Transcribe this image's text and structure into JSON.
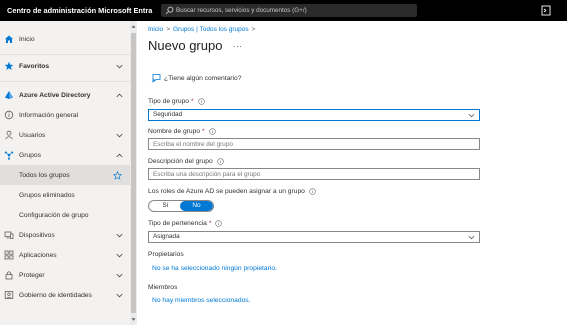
{
  "header": {
    "app_title": "Centro de administración Microsoft Entra",
    "search_placeholder": "Buscar recursos, servicios y documentos (G+/)"
  },
  "sidebar": {
    "items": [
      {
        "label": "Inicio",
        "icon": "home-icon"
      },
      {
        "label": "Favoritos",
        "icon": "star-icon"
      },
      {
        "label": "Azure Active Directory",
        "icon": "azure-ad-icon"
      },
      {
        "label": "Información general",
        "icon": "info-icon"
      },
      {
        "label": "Usuarios",
        "icon": "user-icon"
      },
      {
        "label": "Grupos",
        "icon": "groups-icon"
      },
      {
        "label": "Todos los grupos"
      },
      {
        "label": "Grupos eliminados"
      },
      {
        "label": "Configuración de grupo"
      },
      {
        "label": "Dispositivos",
        "icon": "devices-icon"
      },
      {
        "label": "Aplicaciones",
        "icon": "apps-icon"
      },
      {
        "label": "Proteger",
        "icon": "lock-icon"
      },
      {
        "label": "Gobierno de identidades",
        "icon": "governance-icon"
      }
    ]
  },
  "breadcrumb": {
    "home": "Inicio",
    "groups": "Grupos | Todos los grupos",
    "separator": ">"
  },
  "page": {
    "title": "Nuevo grupo",
    "more": "...",
    "feedback": "¿Tiene algún comentario?"
  },
  "form": {
    "group_type_label": "Tipo de grupo",
    "group_type_value": "Seguridad",
    "group_name_label": "Nombre de grupo",
    "group_name_placeholder": "Escriba el nombre del grupo",
    "description_label": "Descripción del grupo",
    "description_placeholder": "Escriba una descripción para el grupo",
    "roles_label": "Los roles de Azure AD se pueden asignar a un grupo",
    "toggle_yes": "Sí",
    "toggle_no": "No",
    "toggle_selected": "No",
    "membership_label": "Tipo de pertenencia",
    "membership_value": "Asignada",
    "owners_label": "Propietarios",
    "owners_link": "No se ha seleccionado ningún propietario.",
    "members_label": "Miembros",
    "members_link": "No hay miembros seleccionados.",
    "required_mark": "*"
  },
  "colors": {
    "accent": "#0078d4",
    "topbar": "#000000",
    "sidebar": "#f3f2f1",
    "required": "#a4262c"
  }
}
